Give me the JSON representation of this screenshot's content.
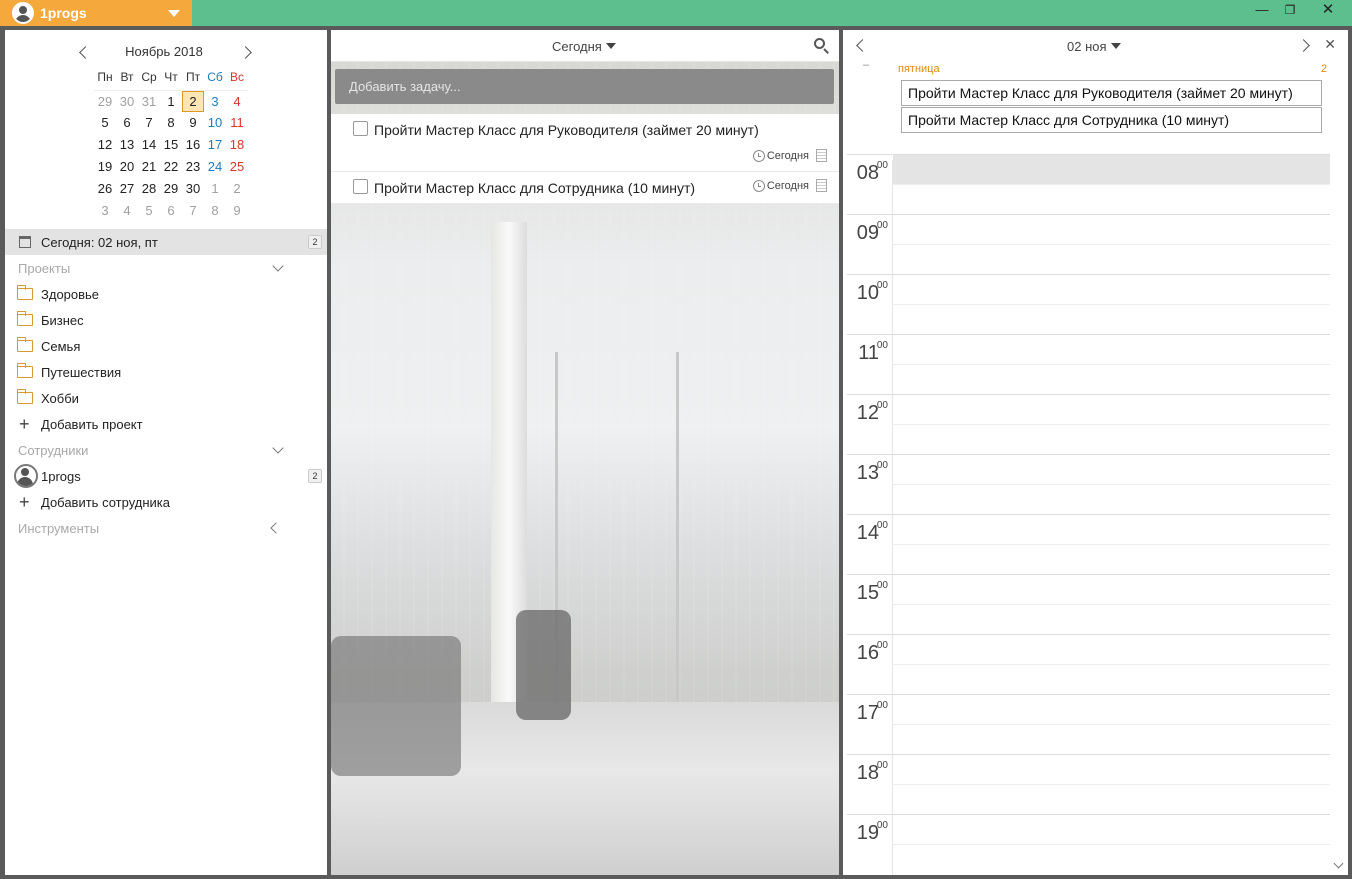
{
  "titlebar": {
    "user": "1progs",
    "window_buttons": [
      "minimize-icon",
      "restore-icon",
      "close-icon"
    ],
    "accent_orange": "#f5a93d",
    "accent_green": "#5dbf8e"
  },
  "calendar": {
    "month_title": "Ноябрь 2018",
    "weekdays": [
      "Пн",
      "Вт",
      "Ср",
      "Чт",
      "Пт",
      "Сб",
      "Вс"
    ],
    "weeks": [
      [
        "29",
        "30",
        "31",
        "1",
        "2",
        "3",
        "4"
      ],
      [
        "5",
        "6",
        "7",
        "8",
        "9",
        "10",
        "11"
      ],
      [
        "12",
        "13",
        "14",
        "15",
        "16",
        "17",
        "18"
      ],
      [
        "19",
        "20",
        "21",
        "22",
        "23",
        "24",
        "25"
      ],
      [
        "26",
        "27",
        "28",
        "29",
        "30",
        "1",
        "2"
      ],
      [
        "3",
        "4",
        "5",
        "6",
        "7",
        "8",
        "9"
      ]
    ],
    "selected_day": "2"
  },
  "sidebar": {
    "today_label": "Сегодня: 02 ноя, пт",
    "today_count": "2",
    "projects_header": "Проекты",
    "projects": [
      "Здоровье",
      "Бизнес",
      "Семья",
      "Путешествия",
      "Хобби"
    ],
    "add_project": "Добавить проект",
    "employees_header": "Сотрудники",
    "employees": [
      {
        "name": "1progs",
        "count": "2"
      }
    ],
    "add_employee": "Добавить сотрудника",
    "tools_header": "Инструменты"
  },
  "tasks_panel": {
    "filter_label": "Сегодня",
    "add_placeholder": "Добавить задачу...",
    "tasks": [
      {
        "title": "Пройти Мастер Класс для Руководителя (займет 20 минут)",
        "due": "Сегодня"
      },
      {
        "title": "Пройти Мастер Класс для Сотрудника (10 минут)",
        "due": "Сегодня"
      }
    ]
  },
  "day_panel": {
    "date_label": "02 ноя",
    "day_name": "пятница",
    "event_count": "2",
    "dash": "–",
    "all_day_events": [
      "Пройти Мастер Класс для Руководителя (займет 20 минут)",
      "Пройти Мастер Класс для Сотрудника (10 минут)"
    ],
    "hours": [
      "08",
      "09",
      "10",
      "11",
      "12",
      "13",
      "14",
      "15",
      "16",
      "17",
      "18",
      "19"
    ],
    "minutes_suffix": "00"
  }
}
